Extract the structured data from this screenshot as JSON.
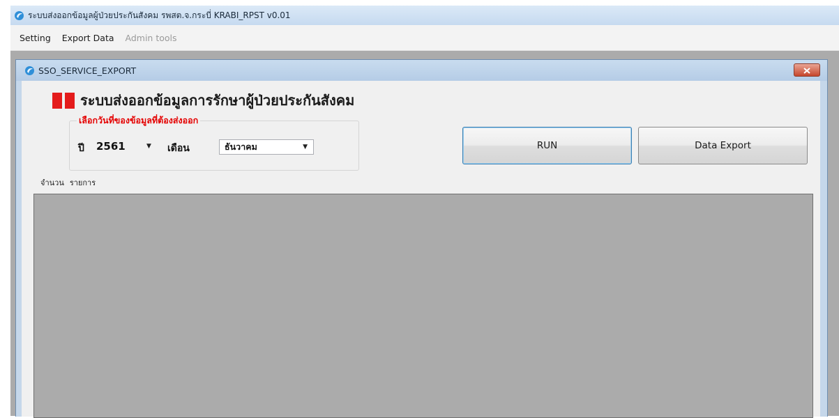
{
  "app": {
    "title": "ระบบส่งออกข้อมูลผู้ป่วยประกันสังคม รพสต.จ.กระบี่ KRABI_RPST v0.01",
    "icon": "app-logo-icon"
  },
  "menu": {
    "items": [
      {
        "label": "Setting",
        "enabled": true
      },
      {
        "label": "Export Data",
        "enabled": true
      },
      {
        "label": "Admin tools",
        "enabled": false
      }
    ]
  },
  "child_window": {
    "title": "SSO_SERVICE_EXPORT",
    "close_icon": "close-x-icon"
  },
  "form": {
    "heading": "ระบบส่งออกข้อมูลการรักษาผู้ป่วยประกันสังคม",
    "group_label": "เลือกวันที่ของข้อมูลที่ต้องส่งออก",
    "year_label": "ปี",
    "year_value": "2561",
    "month_label": "เดือน",
    "month_value": "ธันวาคม",
    "run_button": "RUN",
    "export_button": "Data Export",
    "count_label": "จำนวน",
    "count_unit": "รายการ"
  },
  "colors": {
    "accent_red": "#e41b1b",
    "group_label_red": "#e40000",
    "grid_background": "#ababab",
    "window_frame": "#c5d7ea"
  }
}
